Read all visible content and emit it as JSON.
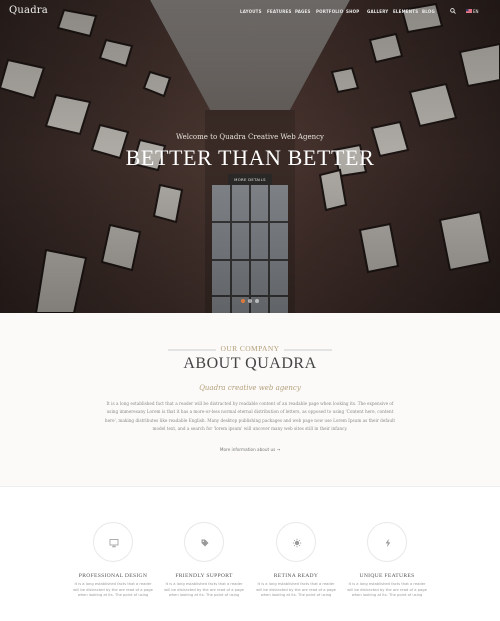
{
  "header": {
    "logo": "Quadra",
    "nav": [
      "LAYOUTS",
      "FEATURES",
      "PAGES",
      "PORTFOLIO",
      "SHOP",
      "GALLERY",
      "ELEMENTS",
      "BLOG"
    ],
    "language": "EN",
    "search_icon": "search-icon",
    "flag_icon": "us-flag-icon"
  },
  "hero": {
    "kicker": "Welcome to Quadra Creative Web Agency",
    "title": "BETTER THAN BETTER",
    "button_label": "MORE DETAILS",
    "slides_count": 3,
    "active_slide": 1
  },
  "about": {
    "kicker": "OUR COMPANY",
    "title": "ABOUT QUADRA",
    "subtitle": "Quadra creative web agency",
    "body_lines": [
      "It is a long established fact that a reader will be distracted by readable content of an readable page when looking its. The expensive of",
      "using immeresany Lorem is that it has a more-or-less normal eternal distribution of letters, as opposed to using 'Content here, content",
      "here', making distributes like readable English. Many desktop publishing packages and web page now use Lorem Ipsum as their default",
      "model text, and a search for 'lorem ipsum' will uncover many web sites still in their infancy."
    ],
    "link": "More information about us →"
  },
  "features": [
    {
      "icon": "monitor-icon",
      "title": "PROFESSIONAL DESIGN",
      "text": "It is a long established facts that a reader will be distracted by the are read of a page when looking at its. The point of using"
    },
    {
      "icon": "tag-icon",
      "title": "FRIENDLY SUPPORT",
      "text": "It is a long established facts that a reader will be distracted by the are read of a page when looking at its. The point of using"
    },
    {
      "icon": "sun-icon",
      "title": "RETINA READY",
      "text": "It is a long established facts that a reader will be distracted by the are read of a page when looking at its. The point of using"
    },
    {
      "icon": "lightning-icon",
      "title": "UNIQUE FEATURES",
      "text": "It is a long established facts that a reader will be distracted by the are read of a page when looking at its. The point of using"
    }
  ],
  "colors": {
    "accent": "#b4a07a",
    "hero_dark": "#2b2220",
    "brick": "#4a3530",
    "active_dot": "#e07a3c"
  }
}
